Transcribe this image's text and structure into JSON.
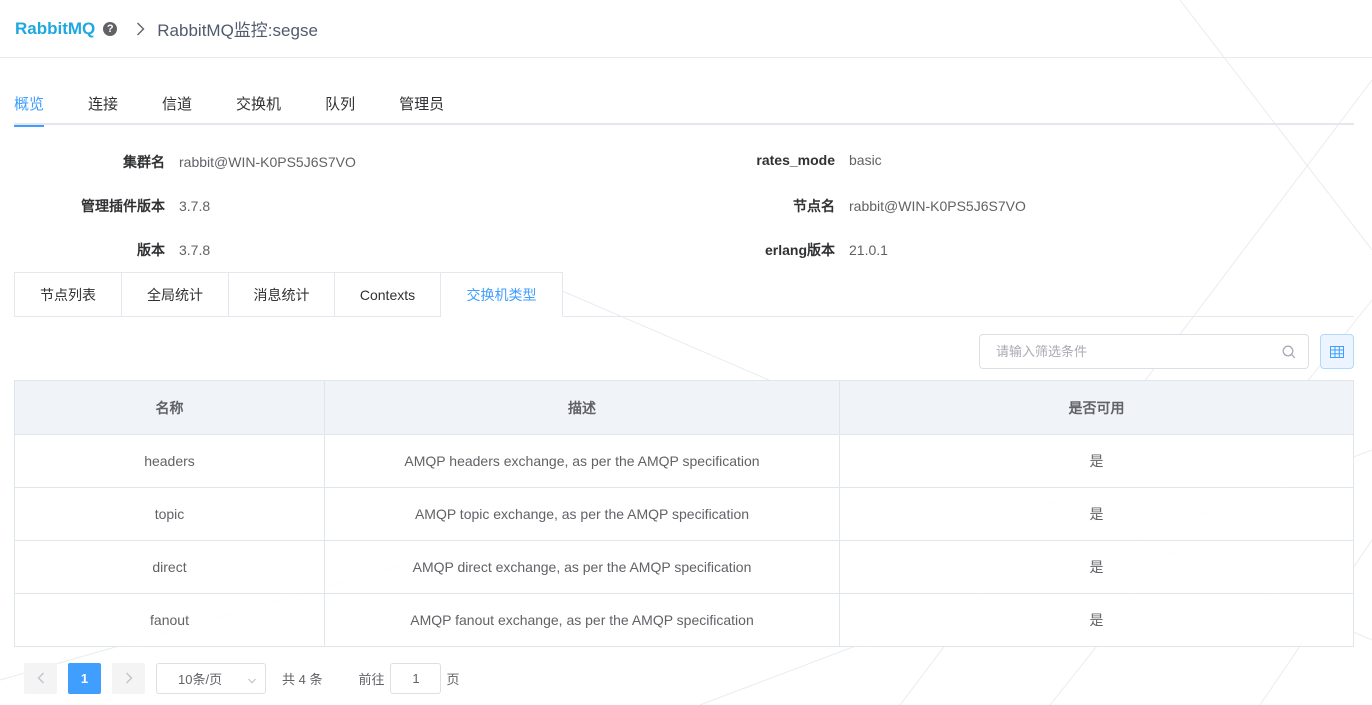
{
  "header": {
    "brand": "RabbitMQ",
    "title": "RabbitMQ监控:segse"
  },
  "top_tabs": [
    "概览",
    "连接",
    "信道",
    "交换机",
    "队列",
    "管理员"
  ],
  "top_tab_active": "概览",
  "info": {
    "cluster_name_label": "集群名",
    "cluster_name": "rabbit@WIN-K0PS5J6S7VO",
    "plugin_version_label": "管理插件版本",
    "plugin_version": "3.7.8",
    "version_label": "版本",
    "version": "3.7.8",
    "rates_mode_label": "rates_mode",
    "rates_mode": "basic",
    "node_name_label": "节点名",
    "node_name": "rabbit@WIN-K0PS5J6S7VO",
    "erlang_label": "erlang版本",
    "erlang": "21.0.1"
  },
  "inner_tabs": [
    "节点列表",
    "全局统计",
    "消息统计",
    "Contexts",
    "交换机类型"
  ],
  "inner_tab_active": "交换机类型",
  "search": {
    "placeholder": "请输入筛选条件"
  },
  "table": {
    "headers": [
      "名称",
      "描述",
      "是否可用"
    ],
    "rows": [
      [
        "headers",
        "AMQP headers exchange, as per the AMQP specification",
        "是"
      ],
      [
        "topic",
        "AMQP topic exchange, as per the AMQP specification",
        "是"
      ],
      [
        "direct",
        "AMQP direct exchange, as per the AMQP specification",
        "是"
      ],
      [
        "fanout",
        "AMQP fanout exchange, as per the AMQP specification",
        "是"
      ]
    ]
  },
  "pagination": {
    "current_page": "1",
    "page_size": "10条/页",
    "total": "共 4 条",
    "goto_label": "前往",
    "goto_value": "1",
    "page_unit": "页"
  },
  "colors": {
    "brand": "#1ea8e0",
    "accent": "#409eff"
  }
}
